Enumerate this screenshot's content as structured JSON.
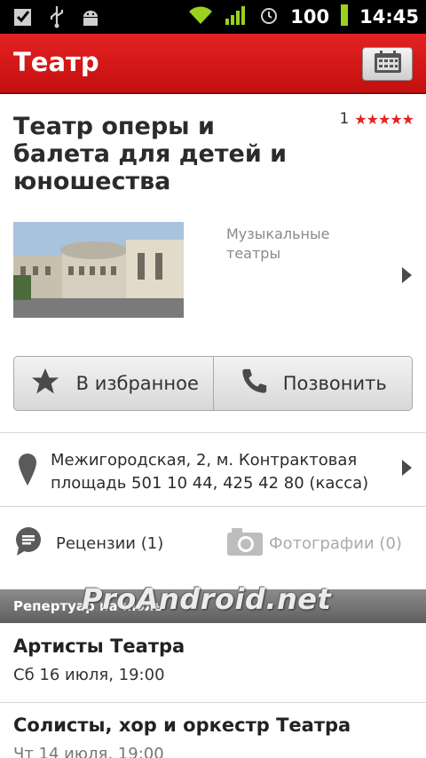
{
  "status_bar": {
    "battery": "100",
    "time": "14:45",
    "icons": [
      "checklist-icon",
      "usb-icon",
      "android-debug-icon",
      "wifi-icon",
      "signal-icon",
      "alarm-icon",
      "battery-icon"
    ]
  },
  "action_bar": {
    "title": "Театр",
    "calendar_icon": "calendar-icon"
  },
  "venue": {
    "title": "Театр оперы и балета для детей и юношества",
    "rating_count": "1",
    "stars": "★★★★★",
    "category": "Музыкальные театры"
  },
  "buttons": {
    "favorite": "В избранное",
    "call": "Позвонить"
  },
  "address": "Межигородская, 2, м. Контрактовая площадь 501 10 44, 425 42 80 (касса)",
  "links": {
    "reviews": "Рецензии (1)",
    "photos": "Фотографии (0)"
  },
  "repertoire": {
    "header": "Репертуар на июль",
    "watermark": "ProAndroid.net",
    "events": [
      {
        "title": "Артисты Театра",
        "date": "Сб 16 июля, 19:00"
      },
      {
        "title": "Солисты, хор и оркестр Театра",
        "date": "Чт 14 июля, 19:00"
      }
    ]
  },
  "colors": {
    "accent": "#d41919",
    "star": "#e02424"
  }
}
